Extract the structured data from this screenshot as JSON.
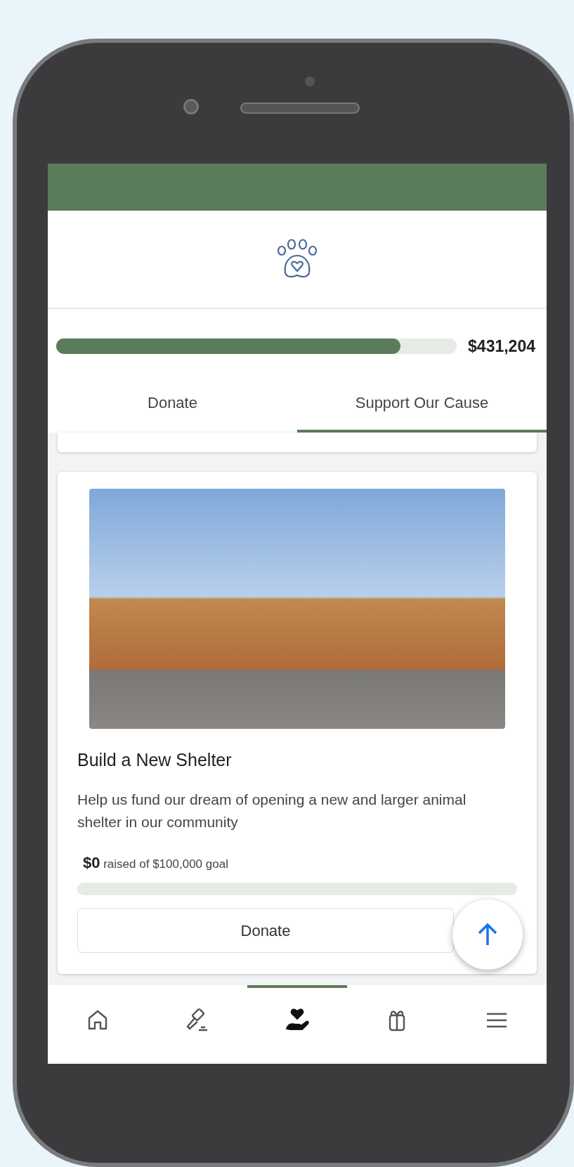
{
  "progress": {
    "level": 0.86,
    "amount": "$431,204"
  },
  "tabs": [
    {
      "label": "Donate",
      "selected": false
    },
    {
      "label": "Support Our Cause",
      "selected": true
    }
  ],
  "cause": {
    "title": "Build a New Shelter",
    "description": "Help us fund our dream of opening a new and larger animal shelter in our community",
    "raised": "$0",
    "goal_text": "raised of $100,000 goal",
    "level": 0,
    "button": "Donate"
  },
  "bottom_nav": [
    {
      "kind": "home",
      "selected": false
    },
    {
      "kind": "gavel",
      "selected": false
    },
    {
      "kind": "donate",
      "selected": true
    },
    {
      "kind": "gift",
      "selected": false
    },
    {
      "kind": "menu",
      "selected": false
    }
  ]
}
